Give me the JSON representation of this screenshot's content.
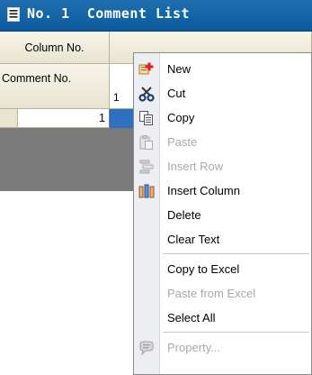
{
  "window": {
    "title": "No. 1  Comment List",
    "title_icon": "document-list-icon"
  },
  "grid": {
    "column_header": "Column No.",
    "row_header": "Comment No.",
    "column_1_label": "1",
    "row_1_value": "1"
  },
  "context_menu": {
    "items": [
      {
        "label": "New",
        "icon": "new-icon",
        "enabled": true
      },
      {
        "label": "Cut",
        "icon": "scissors-icon",
        "enabled": true
      },
      {
        "label": "Copy",
        "icon": "copy-icon",
        "enabled": true
      },
      {
        "label": "Paste",
        "icon": "paste-icon",
        "enabled": false
      },
      {
        "label": "Insert Row",
        "icon": "insert-row-icon",
        "enabled": false
      },
      {
        "label": "Insert Column",
        "icon": "insert-column-icon",
        "enabled": true
      },
      {
        "label": "Delete",
        "icon": "",
        "enabled": true
      },
      {
        "label": "Clear Text",
        "icon": "",
        "enabled": true
      },
      {
        "label": "Copy to Excel",
        "icon": "",
        "enabled": true
      },
      {
        "label": "Paste from Excel",
        "icon": "",
        "enabled": false
      },
      {
        "label": "Select All",
        "icon": "",
        "enabled": true
      },
      {
        "label": "Property...",
        "icon": "property-icon",
        "enabled": false
      }
    ]
  },
  "colors": {
    "title_bar": "#0b5a9e",
    "selection": "#2f6fbf",
    "disabled_text": "#a9a9a9"
  }
}
